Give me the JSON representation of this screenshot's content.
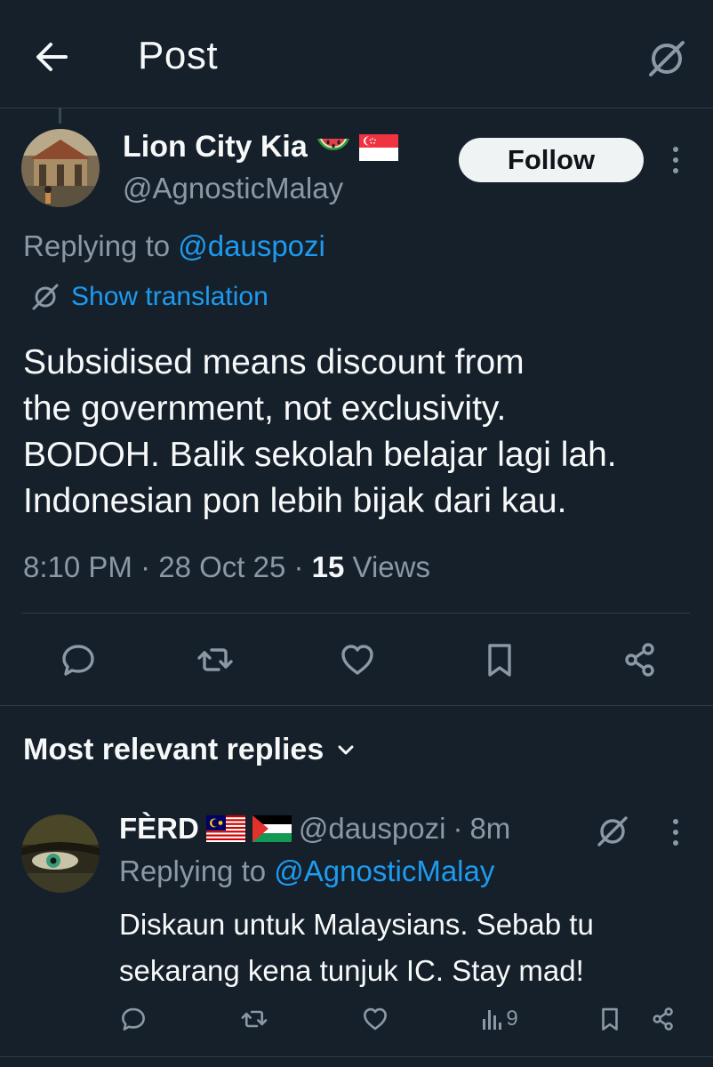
{
  "header": {
    "title": "Post"
  },
  "post": {
    "author_name": "Lion City Kia",
    "author_handle": "@AgnosticMalay",
    "follow_label": "Follow",
    "replying_prefix": "Replying to ",
    "replying_to": "@dauspozi",
    "translate_label": "Show translation",
    "text_lines": [
      "Subsidised means discount from",
      "the government, not exclusivity.",
      "BODOH. Balik sekolah belajar lagi lah.",
      "Indonesian pon lebih bijak dari kau."
    ],
    "time": "8:10 PM",
    "date": "28 Oct 25",
    "views_count": "15",
    "views_label": "Views"
  },
  "replies_section": {
    "sort_label": "Most relevant replies"
  },
  "reply": {
    "name": "FÈRD",
    "handle": "@dauspozi",
    "age": "8m",
    "replying_prefix": "Replying to ",
    "replying_to": "@AgnosticMalay",
    "text_lines": [
      "Diskaun untuk Malaysians. Sebab tu",
      "sekarang kena tunjuk IC. Stay mad!"
    ],
    "views_count": "9"
  },
  "colors": {
    "background": "#15202b",
    "text": "#f7f9f9",
    "muted": "#8b98a5",
    "link": "#1d9bf0",
    "divider": "#2f3b46"
  },
  "icons": [
    "back-arrow-icon",
    "grok-icon",
    "watermelon-emoji",
    "singapore-flag-icon",
    "more-vertical-icon",
    "translate-icon",
    "reply-icon",
    "retweet-icon",
    "like-icon",
    "bookmark-icon",
    "share-icon",
    "chevron-down-icon",
    "malaysia-flag-icon",
    "palestine-flag-icon",
    "views-icon"
  ]
}
